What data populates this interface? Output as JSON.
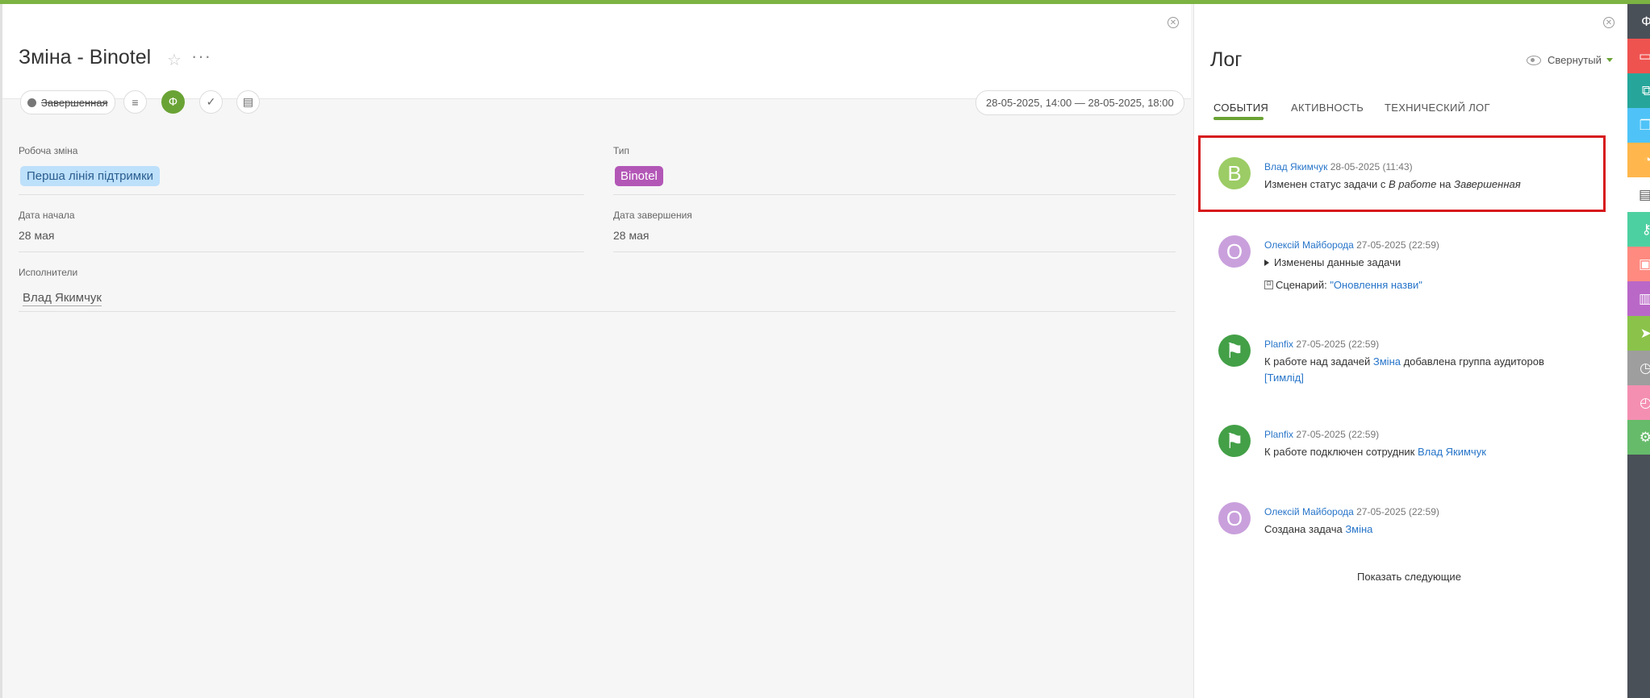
{
  "task": {
    "title": "Зміна - Binotel",
    "status": "Завершенная",
    "date_range": "28-05-2025, 14:00 — 28-05-2025, 18:00",
    "fields": {
      "shift_label": "Робоча зміна",
      "shift_value": "Перша лінія підтримки",
      "type_label": "Тип",
      "type_value": "Binotel",
      "start_label": "Дата начала",
      "start_value": "28 мая",
      "end_label": "Дата завершения",
      "end_value": "28 мая",
      "assignees_label": "Исполнители",
      "assignee_value": "Влад Якимчук"
    },
    "colors": {
      "accent": "#6aa335",
      "shift_tag": "#bde0fb",
      "type_tag": "#b357b7"
    }
  },
  "log": {
    "title": "Лог",
    "collapse_label": "Свернутый",
    "tabs": [
      "СОБЫТИЯ",
      "АКТИВНОСТЬ",
      "ТЕХНИЧЕСКИЙ ЛОГ"
    ],
    "entries": [
      {
        "avatar": "B",
        "author": "Влад Якимчук",
        "time": "28-05-2025 (11:43)",
        "text_prefix": "Изменен статус задачи  с ",
        "from_status": "В работе",
        "mid": " на ",
        "to_status": "Завершенная"
      },
      {
        "avatar": "O",
        "author": "Олексій Майборода",
        "time": "27-05-2025 (22:59)",
        "text": "Изменены данные задачи",
        "script_label": "Сценарий: ",
        "script_name": "\"Оновлення назви\""
      },
      {
        "avatar": "flag",
        "author": "Planfix",
        "time": "27-05-2025 (22:59)",
        "text_prefix": "К работе над задачей ",
        "task_link": "Зміна",
        "text_suffix": " добавлена группа аудиторов",
        "group_link": "[Тимлід]"
      },
      {
        "avatar": "flag",
        "author": "Planfix",
        "time": "27-05-2025 (22:59)",
        "text_prefix": "К работе подключен сотрудник ",
        "user_link": "Влад Якимчук"
      },
      {
        "avatar": "O",
        "author": "Олексій Майборода",
        "time": "27-05-2025 (22:59)",
        "text_prefix": "Создана задача ",
        "task_link": "Зміна"
      }
    ],
    "show_more": "Показать следующие"
  },
  "rail": {
    "icons": [
      {
        "name": "plan-icon",
        "color": "#4a5058",
        "glyph": "Ф"
      },
      {
        "name": "monitor-icon",
        "color": "#ef5350",
        "glyph": "▭"
      },
      {
        "name": "structure-icon",
        "color": "#26a69a",
        "glyph": "⧉"
      },
      {
        "name": "files-icon",
        "color": "#4fc3f7",
        "glyph": "❐"
      },
      {
        "name": "bell-icon",
        "color": "#ffb74d",
        "glyph": "◔"
      },
      {
        "name": "clipboard-icon",
        "color": "#ffffff",
        "glyph": "▤"
      },
      {
        "name": "key-icon",
        "color": "#4dd0a1",
        "glyph": "⚷"
      },
      {
        "name": "contacts-icon",
        "color": "#ff8a80",
        "glyph": "▣"
      },
      {
        "name": "chart-icon",
        "color": "#ba68c8",
        "glyph": "▥"
      },
      {
        "name": "send-icon",
        "color": "#8bc34a",
        "glyph": "➤"
      },
      {
        "name": "analytics-icon",
        "color": "#9e9e9e",
        "glyph": "◷"
      },
      {
        "name": "clock-icon",
        "color": "#f48fb1",
        "glyph": "◴"
      },
      {
        "name": "gear-icon",
        "color": "#66bb6a",
        "glyph": "⚙"
      }
    ]
  }
}
